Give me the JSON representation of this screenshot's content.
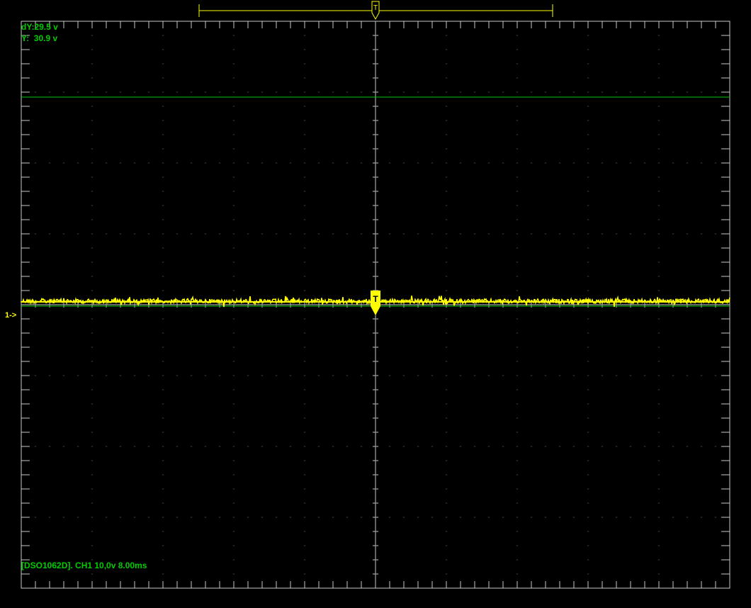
{
  "scope": {
    "model": "DSO1062D",
    "footer_text": "[DSO1062D]. CH1 10,0v 8.00ms",
    "channel": "CH1",
    "volts_per_div": "10,0v",
    "time_per_div": "8.00ms"
  },
  "cursor": {
    "dy_text": "dY:29.5 v",
    "y_text": "Y:  30.9 v"
  },
  "channel_marker": "1->",
  "trigger_marker": "T",
  "colors": {
    "background": "#000000",
    "grid": "#c8c8c8",
    "trace": "#ffff00",
    "cursor": "#00c800",
    "text": "#00cc00",
    "marker": "#ffff00"
  }
}
